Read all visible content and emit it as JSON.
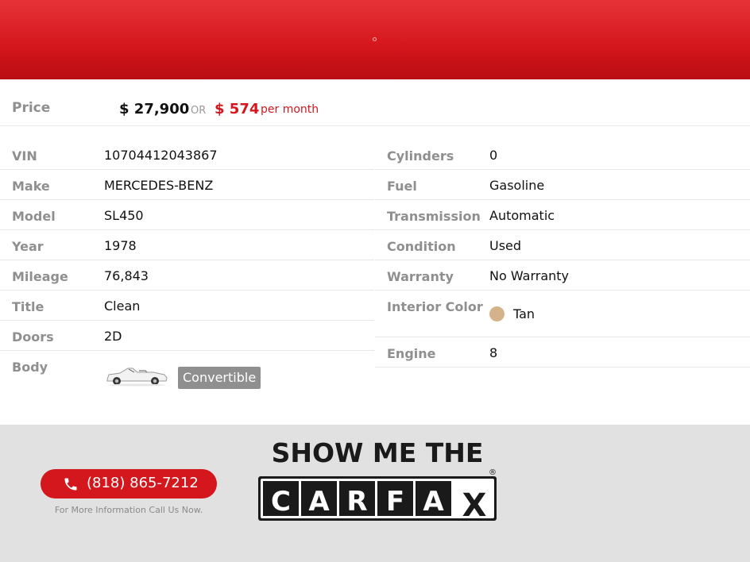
{
  "price": {
    "label": "Price",
    "amount": "$ 27,900",
    "or": "OR",
    "monthly": "$ 574",
    "per_month": "per month"
  },
  "specs_left": [
    {
      "label": "VIN",
      "value": "10704412043867"
    },
    {
      "label": "Make",
      "value": "MERCEDES-BENZ"
    },
    {
      "label": "Model",
      "value": "SL450"
    },
    {
      "label": "Year",
      "value": "1978"
    },
    {
      "label": "Mileage",
      "value": "76,843"
    },
    {
      "label": "Title",
      "value": "Clean"
    },
    {
      "label": "Doors",
      "value": "2D"
    },
    {
      "label": "Body",
      "value": "Convertible"
    }
  ],
  "specs_right": [
    {
      "label": "Cylinders",
      "value": "0"
    },
    {
      "label": "Fuel",
      "value": "Gasoline"
    },
    {
      "label": "Transmission",
      "value": "Automatic"
    },
    {
      "label": "Condition",
      "value": "Used"
    },
    {
      "label": "Warranty",
      "value": "No Warranty"
    },
    {
      "label": "Interior Color",
      "value": "Tan",
      "swatch_color": "#d4b38a"
    },
    {
      "label": "Engine",
      "value": "8"
    }
  ],
  "contact": {
    "phone": "(818) 865-7212",
    "note": "For More Information Call Us Now.",
    "icon": "phone-icon"
  },
  "carfax": {
    "line1": "SHOW ME THE",
    "letters": [
      "C",
      "A",
      "R",
      "F",
      "A",
      "X"
    ],
    "registered": "®"
  },
  "colors": {
    "accent": "#d3171d",
    "label_gray": "#8f8f8f",
    "footer_bg": "#e1e1e1"
  }
}
